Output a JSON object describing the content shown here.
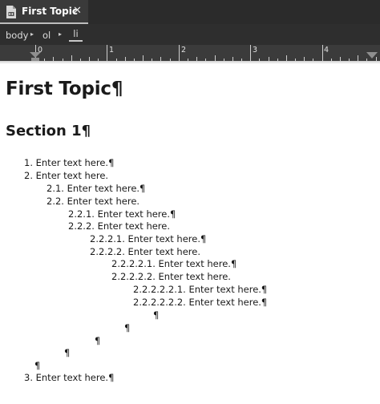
{
  "tab": {
    "title": "First Topic",
    "close_symbol": "✕"
  },
  "breadcrumb": {
    "items": [
      "body",
      "ol",
      "li"
    ],
    "separator": "▸"
  },
  "ruler": {
    "labels": [
      "0",
      "1",
      "2",
      "3",
      "4"
    ]
  },
  "document": {
    "title": "First Topic¶",
    "section": "Section 1¶",
    "lines": [
      "1. Enter text here.¶",
      "2. Enter text here.",
      "2.1. Enter text here.¶",
      "2.2. Enter text here.",
      "2.2.1. Enter text here.¶",
      "2.2.2. Enter text here.",
      "2.2.2.1. Enter text here.¶",
      "2.2.2.2. Enter text here.",
      "2.2.2.2.1. Enter text here.¶",
      "2.2.2.2.2. Enter text here.",
      "2.2.2.2.2.1. Enter text here.¶",
      "2.2.2.2.2.2. Enter text here.¶",
      "¶",
      "¶",
      "¶",
      "¶",
      "¶",
      "3. Enter text here.¶"
    ]
  }
}
